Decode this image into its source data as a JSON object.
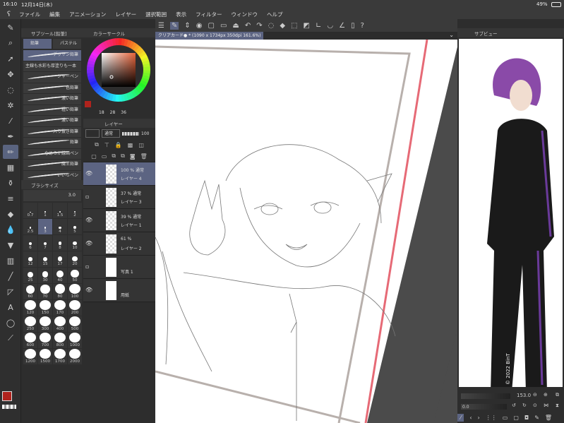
{
  "status": {
    "time": "16:10",
    "date": "12月14日(木)",
    "battery": "49%"
  },
  "menu": [
    "ファイル",
    "編集",
    "アニメーション",
    "レイヤー",
    "選択範囲",
    "表示",
    "フィルター",
    "ウィンドウ",
    "ヘルプ"
  ],
  "subtool": {
    "title": "サブツール[鉛筆]",
    "tabs": [
      "鉛筆",
      "パステル"
    ],
    "items": [
      "デッサン鉛筆",
      "主線も水彩も厚塗りも一本",
      "シャーペン",
      "色鉛筆",
      "濃い鉛筆",
      "粗い鉛筆",
      "濃い鉛筆",
      "入り抜き鉛筆",
      "鉛筆",
      "なめらか線画ペン",
      "魔王鉛筆",
      "いいらペン"
    ]
  },
  "brushsize": {
    "title": "ブラシサイズ",
    "value": "3.0",
    "sizes": [
      "0.7",
      "1",
      "1.5",
      "2",
      "2.5",
      "3",
      "4",
      "5",
      "6",
      "7",
      "8",
      "10",
      "12",
      "15",
      "17",
      "20",
      "25",
      "30",
      "40",
      "50",
      "60",
      "70",
      "80",
      "100",
      "120",
      "150",
      "170",
      "200",
      "250",
      "300",
      "400",
      "500",
      "600",
      "700",
      "800",
      "1000",
      "1200",
      "1500",
      "1700",
      "2000"
    ],
    "selected": "3"
  },
  "color": {
    "title": "カラーサークル",
    "values": [
      "18",
      "28",
      "36"
    ],
    "main_color": "#b0231d",
    "hue_color": "#e8643a"
  },
  "layers": {
    "title": "レイヤー",
    "blend": "通常",
    "opacity": "100",
    "items": [
      {
        "opacity": "100 %",
        "mode": "通常",
        "name": "レイヤー 4",
        "visible": true,
        "selected": true
      },
      {
        "opacity": "37 %",
        "mode": "通常",
        "name": "レイヤー 3",
        "visible": false
      },
      {
        "opacity": "39 %",
        "mode": "通常",
        "name": "レイヤー 1",
        "visible": true
      },
      {
        "opacity": "61 %",
        "mode": "",
        "name": "レイヤー 2",
        "visible": true
      },
      {
        "opacity": "",
        "mode": "",
        "name": "写真 1",
        "visible": false
      },
      {
        "opacity": "",
        "mode": "",
        "name": "用紙",
        "visible": true
      }
    ]
  },
  "document": {
    "tab": "クリアカード● * (1090 x 1734px 350dpi 161.6%)"
  },
  "subview": {
    "title": "サブビュー",
    "zoom": "153.0",
    "rotation": "0.0",
    "watermark": "© 2022 BinT"
  }
}
